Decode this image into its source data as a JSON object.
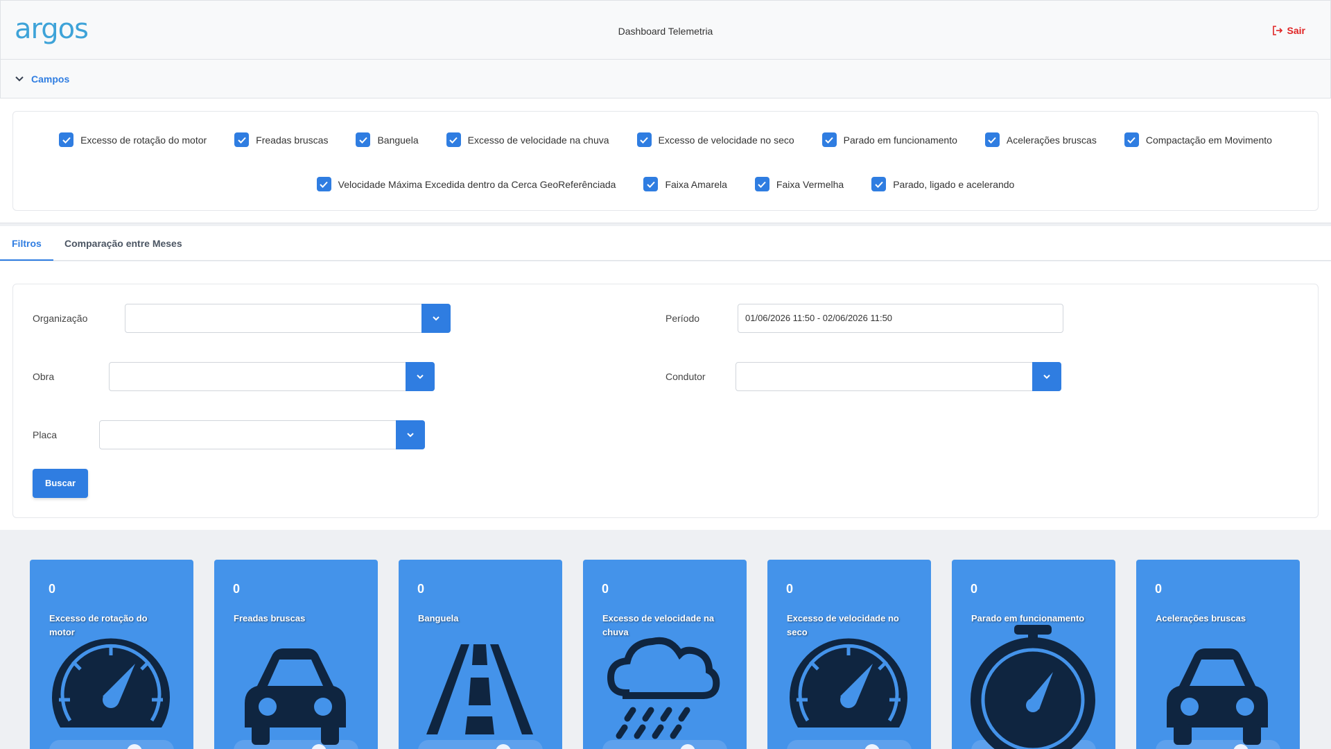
{
  "header": {
    "logo_text": "argos",
    "title": "Dashboard Telemetria",
    "logout_label": "Sair"
  },
  "campos": {
    "label": "Campos",
    "row1": [
      "Excesso de rotação do motor",
      "Freadas bruscas",
      "Banguela",
      "Excesso de velocidade na chuva",
      "Excesso de velocidade no seco",
      "Parado em funcionamento",
      "Acelerações bruscas",
      "Compactação em Movimento"
    ],
    "row2": [
      "Velocidade Máxima Excedida dentro da Cerca GeoReferênciada",
      "Faixa Amarela",
      "Faixa Vermelha",
      "Parado, ligado e acelerando"
    ]
  },
  "tabs": {
    "filtros": "Filtros",
    "comparacao": "Comparação entre Meses"
  },
  "filters": {
    "organizacao_label": "Organização",
    "obra_label": "Obra",
    "placa_label": "Placa",
    "periodo_label": "Período",
    "periodo_value": "01/06/2026 11:50 - 02/06/2026 11:50",
    "condutor_label": "Condutor",
    "buscar_label": "Buscar"
  },
  "cards": [
    {
      "count": "0",
      "label": "Excesso de rotação do motor",
      "icon": "speedometer-icon"
    },
    {
      "count": "0",
      "label": "Freadas bruscas",
      "icon": "car-icon"
    },
    {
      "count": "0",
      "label": "Banguela",
      "icon": "road-icon"
    },
    {
      "count": "0",
      "label": "Excesso de velocidade na chuva",
      "icon": "rain-cloud-icon"
    },
    {
      "count": "0",
      "label": "Excesso de velocidade no seco",
      "icon": "speedometer-icon"
    },
    {
      "count": "0",
      "label": "Parado em funcionamento",
      "icon": "stopwatch-icon"
    },
    {
      "count": "0",
      "label": "Acelerações bruscas",
      "icon": "car-icon"
    }
  ],
  "colors": {
    "primary": "#2f7de1",
    "card_bg": "#4493ea",
    "icon_dark": "#0f2540",
    "logout": "#e02424"
  }
}
